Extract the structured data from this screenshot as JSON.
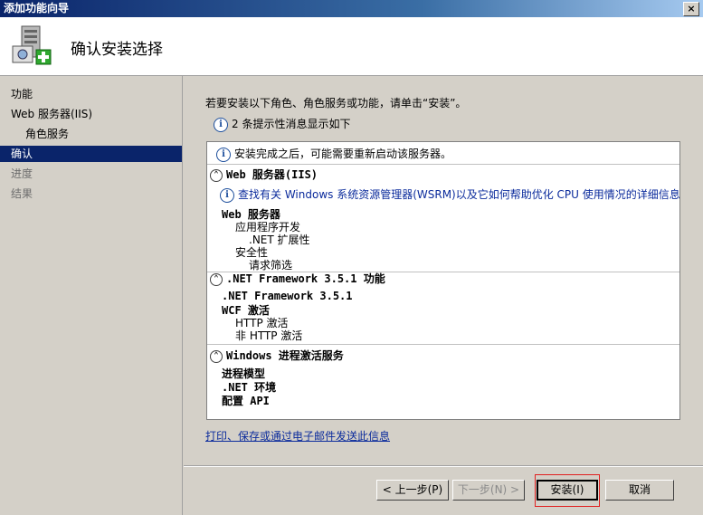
{
  "window": {
    "title": "添加功能向导",
    "close_label": "×"
  },
  "header": {
    "title": "确认安装选择"
  },
  "sidebar": {
    "items": [
      {
        "label": "功能",
        "state": "normal"
      },
      {
        "label": "Web 服务器(IIS)",
        "state": "normal"
      },
      {
        "label": "角色服务",
        "state": "sub"
      },
      {
        "label": "确认",
        "state": "active"
      },
      {
        "label": "进度",
        "state": "dim"
      },
      {
        "label": "结果",
        "state": "dim"
      }
    ]
  },
  "main": {
    "intro": "若要安装以下角色、角色服务或功能，请单击“安装”。",
    "hint": "2 条提示性消息显示如下",
    "restart_note": "安装完成之后，可能需要重新启动该服务器。",
    "sections": [
      {
        "header": "Web 服务器(IIS)",
        "info_link": "查找有关 Windows 系统资源管理器(WSRM)以及它如何帮助优化 CPU 使用情况的详细信息",
        "items": [
          "Web 服务器",
          "应用程序开发",
          ".NET 扩展性",
          "安全性",
          "请求筛选"
        ]
      },
      {
        "header": ".NET Framework 3.5.1 功能",
        "items": [
          ".NET Framework 3.5.1",
          "WCF 激活",
          "HTTP 激活",
          "非 HTTP 激活"
        ]
      },
      {
        "header": "Windows 进程激活服务",
        "items": [
          "进程模型",
          ".NET 环境",
          "配置 API"
        ]
      }
    ],
    "print_link": "打印、保存或通过电子邮件发送此信息"
  },
  "buttons": {
    "prev": "< 上一步(P)",
    "next": "下一步(N) >",
    "install": "安装(I)",
    "cancel": "取消"
  },
  "icons": {
    "info": "info-icon",
    "collapse": "chevron-up-icon",
    "wizard": "server-add-icon"
  }
}
